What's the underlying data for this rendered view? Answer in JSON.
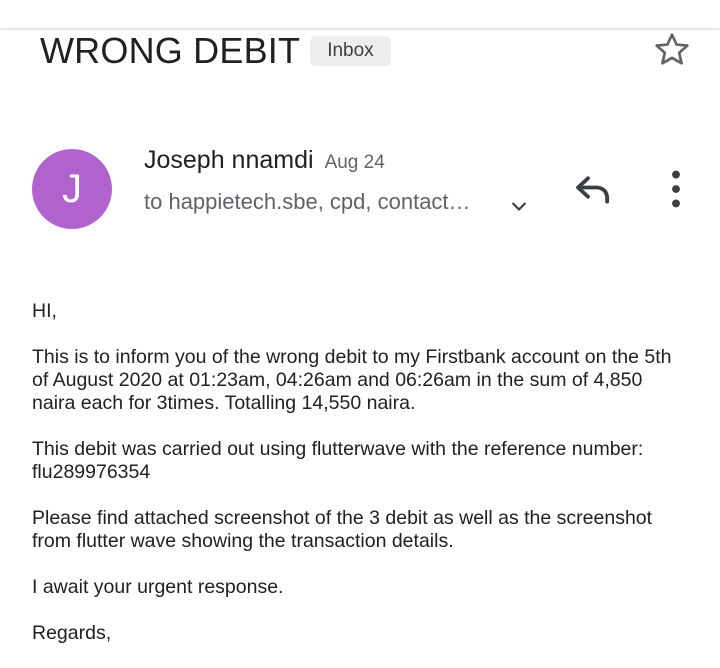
{
  "email": {
    "subject": "WRONG DEBIT",
    "label": "Inbox",
    "sender": {
      "name": "Joseph nnamdi",
      "initial": "J",
      "avatar_color": "#b063cf",
      "date": "Aug 24"
    },
    "recipients": "to happietech.sbe, cpd, contact…",
    "body": [
      "HI,",
      "This is to inform you of the wrong debit to my Firstbank account on the 5th\nof August 2020 at 01:23am, 04:26am and 06:26am in the sum of 4,850\nnaira each for 3times. Totalling 14,550 naira.",
      "This debit was carried out using flutterwave with the reference number:\nflu289976354",
      "Please find attached screenshot of the 3 debit as well as the screenshot\nfrom flutter wave showing the transaction details.",
      "I await your urgent response.",
      "Regards,"
    ]
  },
  "icons": {
    "star": "star-outline-icon",
    "expand": "chevron-down-icon",
    "reply": "reply-icon",
    "more": "more-vert-icon"
  }
}
